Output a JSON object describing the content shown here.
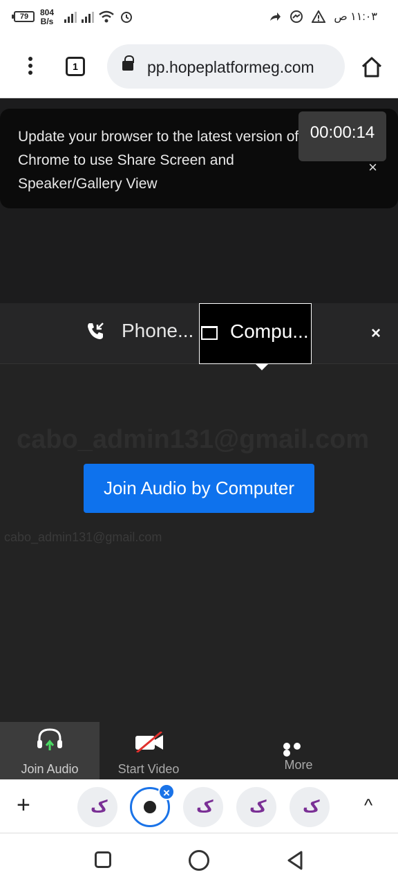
{
  "status_bar": {
    "battery": "79",
    "net_speed_value": "804",
    "net_speed_unit": "B/s",
    "time": "١١:٠٣ ص",
    "icons": [
      "signal-icon",
      "signal-icon",
      "wifi-icon",
      "alarm-icon",
      "call-forward-icon",
      "messenger-icon",
      "warning-icon"
    ]
  },
  "browser": {
    "tab_count": "1",
    "url": "pp.hopeplatformeg.com"
  },
  "meeting": {
    "update_banner": "Update your browser to the latest version of Chrome to use Share Screen and Speaker/Gallery View",
    "banner_close": "×",
    "timer": "00:00:14",
    "audio_tabs": {
      "phone": "Phone...",
      "computer": "Compu..."
    },
    "panel_close": "×",
    "ghost_email": "cabo_admin131@gmail.com",
    "join_button": "Join Audio by Computer",
    "small_email": "cabo_admin131@gmail.com"
  },
  "toolbar": {
    "join_audio": "Join Audio",
    "start_video": "Start Video",
    "more": "More"
  },
  "tabstrip": {
    "add": "+",
    "tab_favicon": "ک",
    "close_badge": "×",
    "expand": "^"
  }
}
